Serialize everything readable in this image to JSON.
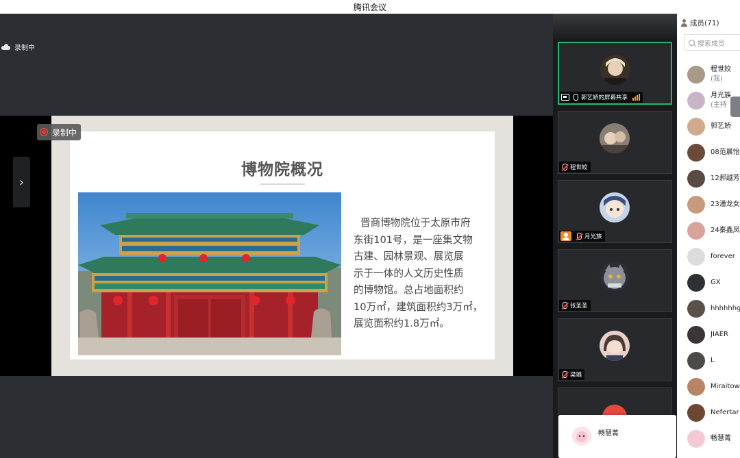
{
  "window": {
    "title": "腾讯会议"
  },
  "recording": {
    "top_label": "录制中",
    "badge_label": "录制中"
  },
  "slide": {
    "title": "博物院概况",
    "body_lines": [
      "晋商博物院位于太原市府",
      "东街101号，是一座集文物",
      "古建、园林景观、展览展",
      "示于一体的人文历史性质",
      "的博物馆。总占地面积约",
      "10万㎡，建筑面积约3万㎡，",
      "展览面积约1.8万㎡。"
    ]
  },
  "video_tiles": [
    {
      "name": "郭艺娇的屏幕共享",
      "status": "speaking",
      "avatar_color": "#3b3026"
    },
    {
      "name": "程世姣",
      "status": "muted",
      "avatar_color": "#8a7f74"
    },
    {
      "name": "月光族",
      "status": "muted",
      "avatar_color": "#c5d4e6"
    },
    {
      "name": "张圣圣",
      "status": "muted",
      "avatar_color": "#8c9099"
    },
    {
      "name": "梁璐",
      "status": "muted",
      "avatar_color": "#e8cfc8"
    }
  ],
  "toast": {
    "name": "畅慧菁"
  },
  "members_panel": {
    "header": "成员(71)",
    "search_placeholder": "搜索成员",
    "members": [
      {
        "name": "程世姣",
        "sub": "(我)",
        "color": "#a89988"
      },
      {
        "name": "月光族",
        "sub": "(主持",
        "color": "#c9b4c7"
      },
      {
        "name": "郭艺娇",
        "sub": "",
        "color": "#d1a98f"
      },
      {
        "name": "08范晨怡",
        "sub": "",
        "color": "#6b4a3a"
      },
      {
        "name": "12郝越芳",
        "sub": "",
        "color": "#5a4a44"
      },
      {
        "name": "23潘龙女",
        "sub": "",
        "color": "#c59a7d"
      },
      {
        "name": "24秦鑫凤",
        "sub": "",
        "color": "#d8a49a"
      },
      {
        "name": "forever",
        "sub": "",
        "color": "#dcdcdc"
      },
      {
        "name": "GX",
        "sub": "",
        "color": "#2f3033"
      },
      {
        "name": "hhhhhhg",
        "sub": "",
        "color": "#5a5149"
      },
      {
        "name": "JIAER",
        "sub": "",
        "color": "#3a3536"
      },
      {
        "name": "L",
        "sub": "",
        "color": "#4d4a47"
      },
      {
        "name": "Miraitow",
        "sub": "",
        "color": "#b88464"
      },
      {
        "name": "Nefertar",
        "sub": "",
        "color": "#6e4634"
      },
      {
        "name": "畅慧菁",
        "sub": "",
        "color": "#f4c9d5"
      }
    ]
  }
}
